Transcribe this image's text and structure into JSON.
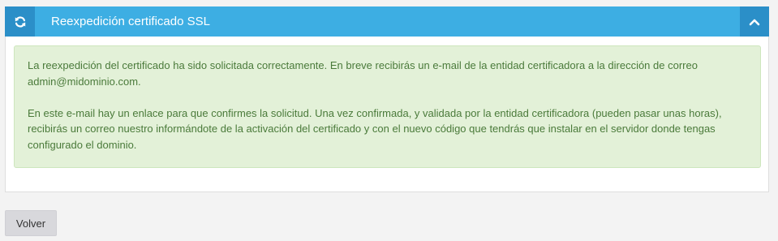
{
  "panel": {
    "title": "Reexpedición certificado SSL",
    "refresh_icon": "refresh-icon",
    "collapse_icon": "chevron-up-icon",
    "header_color": "#3daee3",
    "header_icon_bg": "#2b8fc8"
  },
  "alert": {
    "paragraph_1": "La reexpedición del certificado ha sido solicitada correctamente. En breve recibirás un e-mail de la entidad certificadora a la dirección de correo admin@midominio.com.",
    "paragraph_2": "En este e-mail hay un enlace para que confirmes la solicitud. Una vez confirmada, y validada por la entidad certificadora (pueden pasar unas horas), recibirás un correo nuestro informándote de la activación del certificado y con el nuevo código que tendrás que instalar en el servidor donde tengas configurado el dominio.",
    "background": "#e3f1d8",
    "text_color": "#4a7a3a"
  },
  "actions": {
    "back_label": "Volver"
  }
}
